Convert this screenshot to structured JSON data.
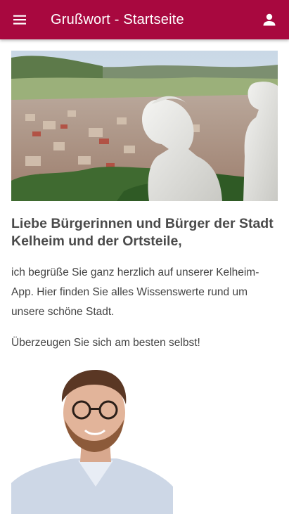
{
  "app_bar": {
    "title": "Grußwort - Startseite",
    "color": "#a8083f",
    "menu_icon": "menu-icon",
    "account_icon": "account-icon"
  },
  "main": {
    "hero_image": "Kelheim town panorama with marble statue",
    "heading": "Liebe Bürgerinnen und Bürger der Stadt Kelheim und der Ortsteile,",
    "paragraph_1": "ich begrüße Sie ganz herzlich auf unserer Kelheim-App. Hier finden Sie alles Wissenswerte rund um unsere schöne Stadt.",
    "paragraph_2": "Überzeugen Sie sich am besten selbst!",
    "portrait_image": "portrait of smiling man with glasses"
  }
}
